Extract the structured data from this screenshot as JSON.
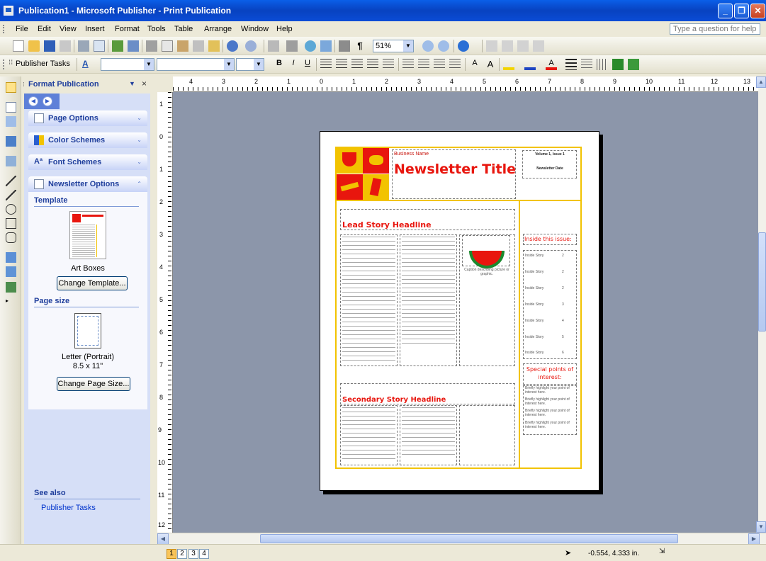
{
  "window": {
    "title": "Publication1 - Microsoft Publisher - Print Publication",
    "min": "_",
    "max": "❐",
    "close": "✕"
  },
  "menu": {
    "items": [
      "File",
      "Edit",
      "View",
      "Insert",
      "Format",
      "Tools",
      "Table",
      "Arrange",
      "Window",
      "Help"
    ],
    "help_placeholder": "Type a question for help"
  },
  "toolbar": {
    "zoom": "51%",
    "publisher_tasks": "Publisher Tasks"
  },
  "taskpane": {
    "title": "Format Publication",
    "sections": [
      "Page Options",
      "Color Schemes",
      "Font Schemes",
      "Newsletter Options"
    ],
    "template_header": "Template",
    "template_name": "Art Boxes",
    "change_template": "Change Template...",
    "page_size_header": "Page size",
    "page_size_name": "Letter (Portrait)",
    "page_size_dims": "8.5 x 11\"",
    "change_page_size": "Change Page Size...",
    "see_also": "See also",
    "publisher_tasks_link": "Publisher Tasks"
  },
  "ruler": {
    "h_numbers": [
      "4",
      "3",
      "2",
      "1",
      "0",
      "1",
      "2",
      "3",
      "4",
      "5",
      "6",
      "7",
      "8",
      "9",
      "10",
      "11",
      "12",
      "13"
    ],
    "v_numbers": [
      "1",
      "0",
      "1",
      "2",
      "3",
      "4",
      "5",
      "6",
      "7",
      "8",
      "9",
      "10",
      "11",
      "12"
    ]
  },
  "newsletter": {
    "business_name": "Business Name",
    "title": "Newsletter Title",
    "volume": "Volume 1, Issue 1",
    "date": "Newsletter Date",
    "lead_headline": "Lead Story Headline",
    "caption": "Caption describing picture or graphic.",
    "inside_title": "Inside this issue:",
    "inside_items": [
      {
        "label": "Inside Story",
        "page": "2"
      },
      {
        "label": "Inside Story",
        "page": "2"
      },
      {
        "label": "Inside Story",
        "page": "2"
      },
      {
        "label": "Inside Story",
        "page": "3"
      },
      {
        "label": "Inside Story",
        "page": "4"
      },
      {
        "label": "Inside Story",
        "page": "5"
      },
      {
        "label": "Inside Story",
        "page": "6"
      }
    ],
    "special_title": "Special points of interest:",
    "special_items": [
      "Briefly highlight your point of interest here.",
      "Briefly highlight your point of interest here.",
      "Briefly highlight your point of interest here.",
      "Briefly highlight your point of interest here."
    ],
    "secondary_headline": "Secondary Story Headline"
  },
  "status": {
    "pages": [
      "1",
      "2",
      "3",
      "4"
    ],
    "coords": "-0.554, 4.333 in."
  }
}
